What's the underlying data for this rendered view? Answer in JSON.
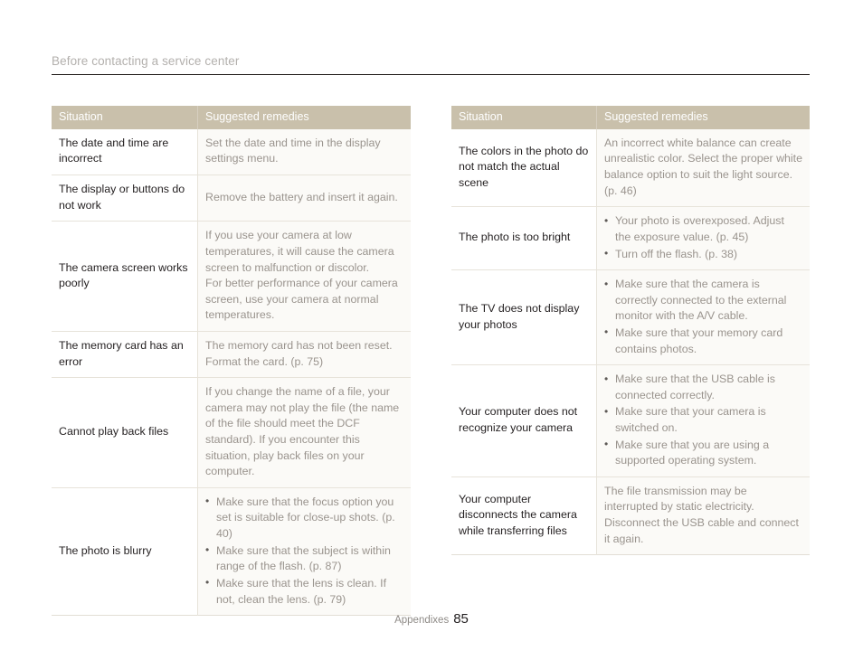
{
  "header": {
    "title": "Before contacting a service center"
  },
  "footer": {
    "section_label": "Appendixes",
    "page_number": "85"
  },
  "colors": {
    "table_header_bg": "#c9c0ab",
    "table_header_text": "#ffffff",
    "situation_text": "#231f20",
    "remedy_text": "#9a948e",
    "remedy_bg": "#fbfaf7",
    "row_divider": "#e7e3da",
    "title_text": "#b3b0ad",
    "title_rule": "#1c1715"
  },
  "bullet_glyph": "•",
  "tables": [
    {
      "id": "left-table",
      "columns": [
        "Situation",
        "Suggested remedies"
      ],
      "rows": [
        {
          "situation": "The date and time are incorrect",
          "remedy_type": "paragraph",
          "remedy": "Set the date and time in the display settings menu."
        },
        {
          "situation": "The display or buttons do not work",
          "remedy_type": "paragraph",
          "remedy": "Remove the battery and insert it again."
        },
        {
          "situation": "The camera screen works poorly",
          "remedy_type": "paragraph",
          "remedy": "If you use your camera at low temperatures, it will cause the camera screen to malfunction or discolor.\nFor better performance of your camera screen, use your camera at normal temperatures."
        },
        {
          "situation": "The memory card has an error",
          "remedy_type": "paragraph",
          "remedy": "The memory card has not been reset. Format the card. (p. 75)"
        },
        {
          "situation": "Cannot play back files",
          "remedy_type": "paragraph",
          "remedy": "If you change the name of a file, your camera may not play the file (the name of the file should meet the DCF standard). If you encounter this situation, play back files on your computer."
        },
        {
          "situation": "The photo is blurry",
          "remedy_type": "bullets",
          "bullets": [
            "Make sure that the focus option you set is suitable for close-up shots. (p. 40)",
            "Make sure that the subject is within range of the flash. (p. 87)",
            "Make sure that the lens is clean. If not, clean the lens. (p. 79)"
          ]
        }
      ]
    },
    {
      "id": "right-table",
      "columns": [
        "Situation",
        "Suggested remedies"
      ],
      "rows": [
        {
          "situation": "The colors in the photo do not match the actual scene",
          "remedy_type": "paragraph",
          "remedy": "An incorrect white balance can create unrealistic color. Select the proper white balance option to suit the light source. (p. 46)"
        },
        {
          "situation": "The photo is too bright",
          "remedy_type": "bullets",
          "bullets": [
            "Your photo is overexposed. Adjust the exposure value. (p. 45)",
            "Turn off the flash. (p. 38)"
          ]
        },
        {
          "situation": "The TV does not display your photos",
          "remedy_type": "bullets",
          "bullets": [
            "Make sure that the camera is correctly connected to the external monitor with the A/V cable.",
            "Make sure that your memory card contains photos."
          ]
        },
        {
          "situation": "Your computer does not recognize your camera",
          "remedy_type": "bullets",
          "bullets": [
            "Make sure that the USB cable is connected correctly.",
            "Make sure that your camera is switched on.",
            "Make sure that you are using a supported operating system."
          ]
        },
        {
          "situation": "Your computer disconnects the camera while transferring files",
          "remedy_type": "paragraph",
          "remedy": "The file transmission may be interrupted by static electricity. Disconnect the USB cable and connect it again."
        }
      ]
    }
  ]
}
